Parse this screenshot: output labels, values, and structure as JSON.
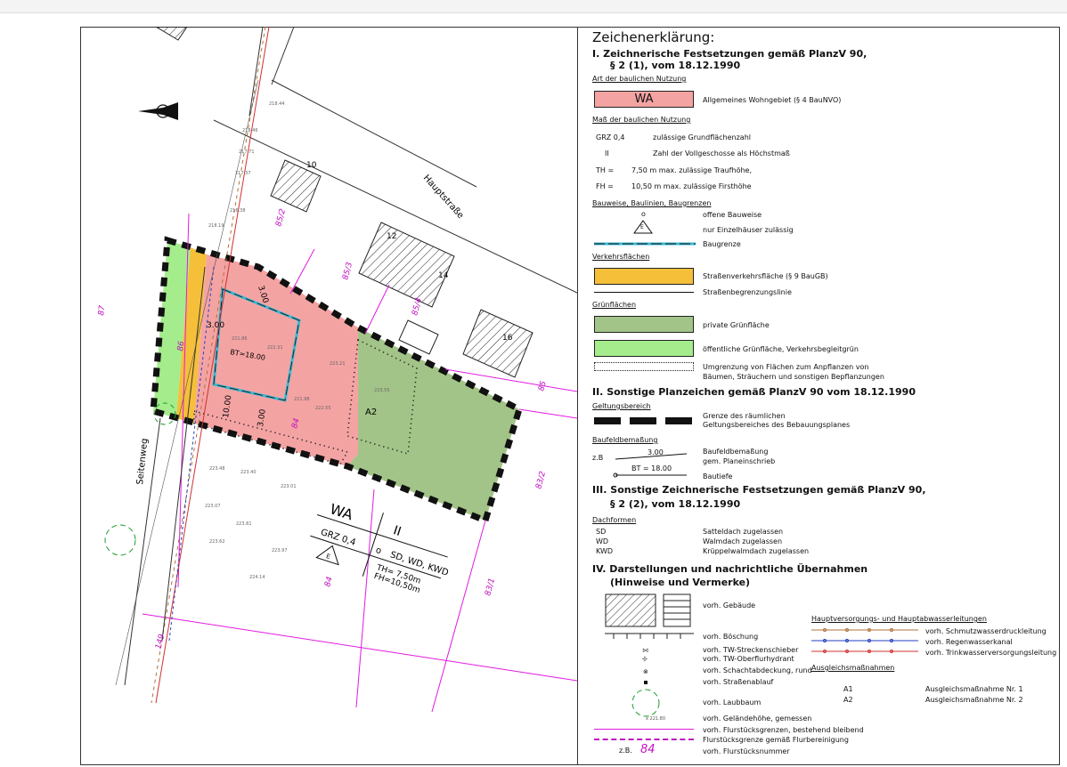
{
  "map": {
    "street_main": "Hauptstraße",
    "street_side": "Seitenweg",
    "zone": {
      "code": "WA",
      "floors": "II",
      "grz": "GRZ 0,4",
      "bauweise": "o",
      "roofs": "SD, WD, KWD",
      "th": "TH= 7,50m",
      "fh": "FH=10,50m",
      "e": "E"
    },
    "parcels": [
      "87",
      "86",
      "85/2",
      "85/3",
      "85/4",
      "85",
      "84",
      "83/2",
      "83/1",
      "84",
      "149"
    ],
    "houses": [
      "10",
      "12",
      "14",
      "16"
    ],
    "dims": {
      "d1": "3.00",
      "d2": "3.00",
      "d3": "10.00",
      "d4": "3.00",
      "bt": "BT=18.00"
    },
    "comp": "A2",
    "heights": [
      "218.46",
      "217.71",
      "217.37",
      "216.38",
      "218.44",
      "218.19",
      "221.86",
      "222.31",
      "223.21",
      "221.98",
      "222.55",
      "223.55",
      "223.48",
      "223.40",
      "223.01",
      "223.07",
      "223.81",
      "223.62",
      "223.97",
      "224.14"
    ]
  },
  "legend": {
    "title": "Zeichenerklärung:",
    "s1a": "I.  Zeichnerische Festsetzungen gemäß PlanzV 90,",
    "s1b": "§ 2 (1), vom 18.12.1990",
    "art_head": "Art der baulichen Nutzung",
    "wa_label": "WA",
    "wa_text": "Allgemeines Wohngebiet  (§ 4 BauNVO)",
    "mass_head": "Maß der baulichen Nutzung",
    "grz_code": "GRZ 0,4",
    "grz_text": "zulässige Grundflächenzahl",
    "ii_code": "II",
    "ii_text": "Zahl der Vollgeschosse als Höchstmaß",
    "th_code": "TH  =",
    "th_text": "7,50 m max. zulässige Traufhöhe,",
    "fh_code": "FH  =",
    "fh_text": "10,50 m max. zulässige Firsthöhe",
    "bau_head": "Bauweise, Baulinien, Baugrenzen",
    "o_code": "o",
    "o_text": "offene Bauweise",
    "e_code": "E",
    "e_text": "nur Einzelhäuser zulässig",
    "bg_text": "Baugrenze",
    "verk_head": "Verkehrsflächen",
    "verk_text": "Straßenverkehrsfläche  (§ 9 BauGB)",
    "sbl_text": "Straßenbegrenzungslinie",
    "gruen_head": "Grünflächen",
    "priv_text": "private Grünfläche",
    "oeff_text": "öffentliche Grünfläche, Verkehrsbegleitgrün",
    "pfl_text1": "Umgrenzung von Flächen zum Anpflanzen von",
    "pfl_text2": "Bäumen, Sträuchern und sonstigen Bepflanzungen",
    "s2": "II.  Sonstige Planzeichen gemäß PlanzV 90 vom 18.12.1990",
    "geltung_head": "Geltungsbereich",
    "geltung_text1": "Grenze des räumlichen",
    "geltung_text2": "Geltungsbereiches des Bebauungsplanes",
    "baufeld_head": "Baufeldbemaßung",
    "zb": "z.B",
    "bf_dim": "3.00",
    "bf_bt": "BT = 18.00",
    "bf_text1": "Baufeldbemaßung",
    "bf_text2": "gem. Planeinschrieb",
    "bf_text3": "Bautiefe",
    "s3a": "III.  Sonstige Zeichnerische Festsetzungen gemäß PlanzV 90,",
    "s3b": "§ 2 (2), vom 18.12.1990",
    "dach_head": "Dachformen",
    "sd_code": "SD",
    "sd_text": "Satteldach zugelassen",
    "wd_code": "WD",
    "wd_text": "Walmdach zugelassen",
    "kwd_code": "KWD",
    "kwd_text": "Krüppelwalmdach zugelassen",
    "s4a": "IV.  Darstellungen und nachrichtliche Übernahmen",
    "s4b": "(Hinweise und Vermerke)",
    "geb_text": "vorh. Gebäude",
    "bosch_text": "vorh. Böschung",
    "tw1_text": "vorh. TW-Streckenschieber",
    "tw2_text": "vorh. TW-Oberflurhydrant",
    "scha_text": "vorh. Schachtabdeckung, rund",
    "abl_text": "vorh. Straßenablauf",
    "baum_text": "vorh. Laubbaum",
    "hoehe_sample": "x 221.80",
    "gel_text": "vorh. Geländehöhe, gemessen",
    "flur1_text": "vorh. Flurstücksgrenzen, bestehend bleibend",
    "flur2_text": "Flurstücksgrenze gemäß Flurbereinigung",
    "flnr_zb": "z.B.",
    "flnr_num": "84",
    "flnr_text": "vorh. Flurstücksnummer",
    "haupt_head": "Hauptversorgungs- und Hauptabwasserleitungen",
    "schm_text": "vorh. Schmutzwasserdruckleitung",
    "reg_text": "vorh. Regenwasserkanal",
    "trink_text": "vorh. Trinkwasserversorgungsleitung",
    "ausgl_head": "Ausgleichsmaßnahmen",
    "a1_code": "A1",
    "a1_text": "Ausgleichsmaßnahme Nr. 1",
    "a2_code": "A2",
    "a2_text": "Ausgleichsmaßnahme Nr. 2"
  },
  "colors": {
    "wa": "#f4a3a3",
    "verkehr": "#f5bf3a",
    "privgruen": "#a3c488",
    "oeffgruen": "#a4ec8c",
    "baugrenze": "#3ab8d4",
    "parcel": "#e01be0",
    "water_brown": "#b0703a",
    "water_blue": "#2040c0",
    "water_red": "#d03030"
  }
}
